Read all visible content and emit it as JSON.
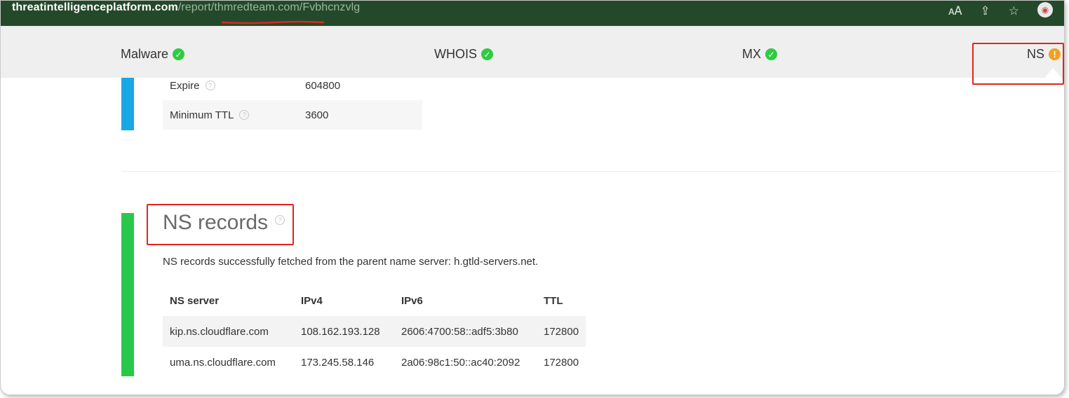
{
  "url": {
    "host": "threatintelligenceplatform.com",
    "path_prefix": "/report/",
    "domain": "thmredteam.com",
    "path_suffix": "/Fvbhcnzvlg"
  },
  "browser_icons": [
    "translate-icon",
    "share-icon",
    "star-icon",
    "profile-icon"
  ],
  "tabs": [
    {
      "label": "Malware",
      "status": "ok"
    },
    {
      "label": "WHOIS",
      "status": "ok"
    },
    {
      "label": "MX",
      "status": "ok"
    },
    {
      "label": "NS",
      "status": "warning"
    }
  ],
  "soa_rows": [
    {
      "label": "Expire",
      "value": "604800"
    },
    {
      "label": "Minimum TTL",
      "value": "3600"
    }
  ],
  "ns_section": {
    "title": "NS records",
    "description": "NS records successfully fetched from the parent name server: h.gtld-servers.net.",
    "columns": [
      "NS server",
      "IPv4",
      "IPv6",
      "TTL"
    ],
    "rows": [
      [
        "kip.ns.cloudflare.com",
        "108.162.193.128",
        "2606:4700:58::adf5:3b80",
        "172800"
      ],
      [
        "uma.ns.cloudflare.com",
        "173.245.58.146",
        "2a06:98c1:50::ac40:2092",
        "172800"
      ]
    ]
  },
  "colors": {
    "addressbar": "#24492a",
    "ok": "#2ecc40",
    "warning": "#f0a020",
    "soa_accent": "#1aa7e6",
    "ns_accent": "#2ac84a",
    "highlight": "#e0261c"
  }
}
